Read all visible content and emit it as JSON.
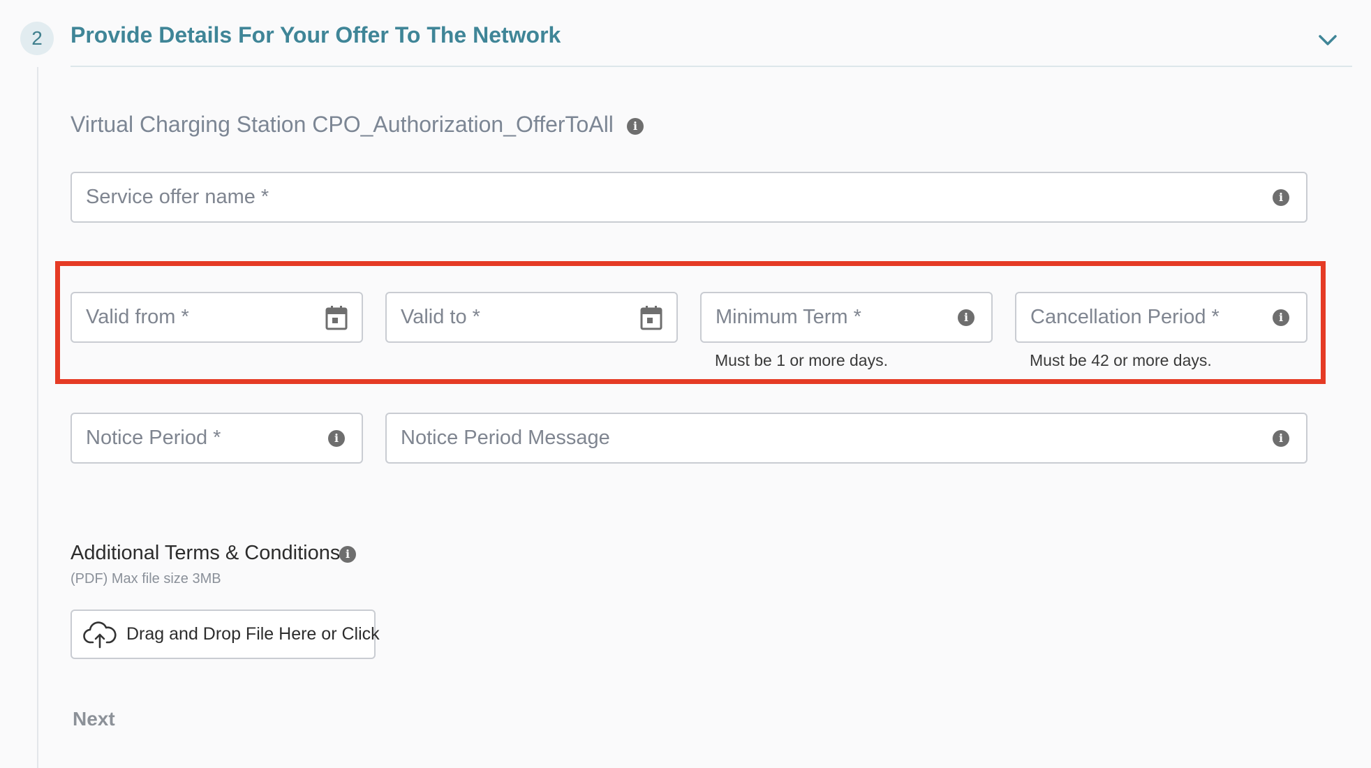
{
  "section": {
    "step_number": "2",
    "title": "Provide Details For Your Offer To The Network"
  },
  "offer": {
    "label": "Virtual Charging Station CPO_Authorization_OfferToAll"
  },
  "fields": {
    "service_offer_name": {
      "placeholder": "Service offer name *"
    },
    "valid_from": {
      "placeholder": "Valid from *"
    },
    "valid_to": {
      "placeholder": "Valid to *"
    },
    "minimum_term": {
      "placeholder": "Minimum Term *",
      "hint": "Must be 1 or more days."
    },
    "cancellation_period": {
      "placeholder": "Cancellation Period *",
      "hint": "Must be 42 or more days."
    },
    "notice_period": {
      "placeholder": "Notice Period *"
    },
    "notice_period_message": {
      "placeholder": "Notice Period Message"
    }
  },
  "terms": {
    "label": "Additional Terms & Conditions",
    "sub": "(PDF) Max file size 3MB",
    "upload_label": "Drag and Drop File Here or Click"
  },
  "actions": {
    "next_label": "Next"
  },
  "icons": {
    "info": "info-icon",
    "calendar": "calendar-icon",
    "chevron": "chevron-down-icon",
    "upload": "cloud-upload-icon"
  },
  "colors": {
    "accent": "#3f8597",
    "highlight": "#e53b25",
    "info_icon": "#6e6e6e"
  }
}
